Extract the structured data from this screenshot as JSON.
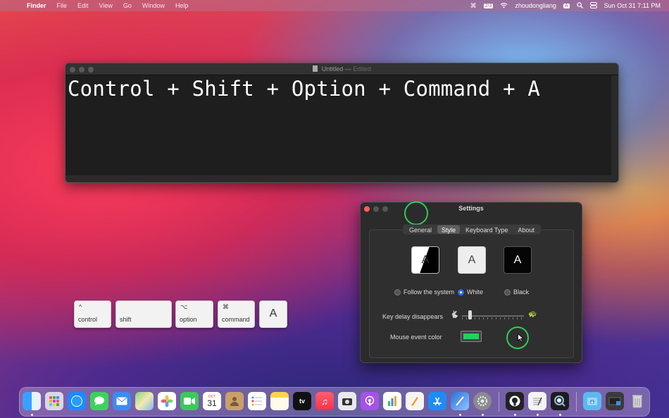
{
  "menubar": {
    "app_name": "Finder",
    "items": [
      "File",
      "Edit",
      "View",
      "Go",
      "Window",
      "Help"
    ],
    "user": "zhoudongliang",
    "input_badge": "2/3",
    "keyboard_badge": "A",
    "datetime": "Sun Oct 31  7:11 PM"
  },
  "textedit": {
    "title": "Untitled",
    "separator": "—",
    "edited": "Edited",
    "content": "Control + Shift + Option + Command + A"
  },
  "settings": {
    "title": "Settings",
    "tabs": [
      "General",
      "Style",
      "Keyboard Type",
      "About"
    ],
    "active_tab": "Style",
    "style_sample_letter": "A",
    "radio_follow": "Follow the system",
    "radio_white": "White",
    "radio_black": "Black",
    "selected_style": "White",
    "delay_label": "Key delay disappears",
    "mouse_label": "Mouse event color",
    "mouse_color": "#1fd45a",
    "ring_color": "#2ecc5a"
  },
  "keys": {
    "control": {
      "symbol": "^",
      "label": "control"
    },
    "shift": {
      "symbol": "",
      "label": "shift"
    },
    "option": {
      "symbol": "⌥",
      "label": "option"
    },
    "command": {
      "symbol": "⌘",
      "label": "command"
    },
    "letter": "A"
  },
  "dock": {
    "calendar_month": "OCT",
    "calendar_day": "31",
    "tv_label": "tv"
  }
}
